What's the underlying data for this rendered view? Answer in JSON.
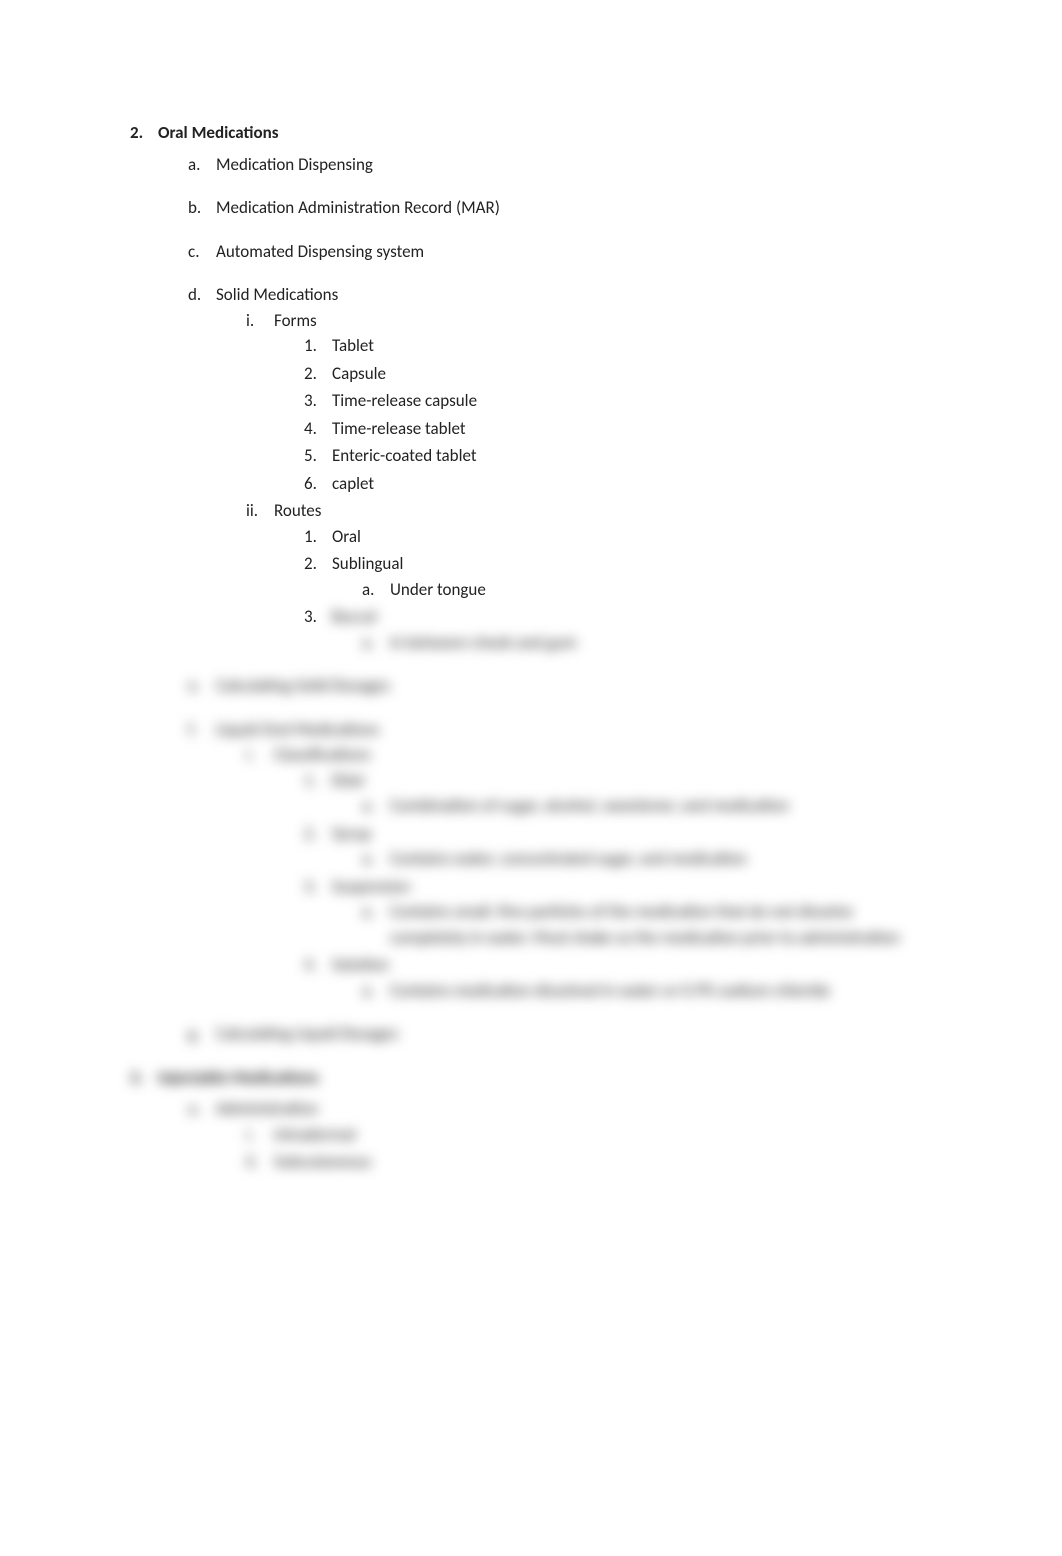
{
  "section": {
    "number": "2.",
    "title": "Oral Medications",
    "items": [
      {
        "marker": "a.",
        "text": "Medication Dispensing"
      },
      {
        "marker": "b.",
        "text": "Medication Administration Record (MAR)"
      },
      {
        "marker": "c.",
        "text": "Automated Dispensing system"
      },
      {
        "marker": "d.",
        "text": "Solid Medications",
        "sub": [
          {
            "marker": "i.",
            "text": "Forms",
            "sub": [
              {
                "marker": "1.",
                "text": "Tablet"
              },
              {
                "marker": "2.",
                "text": "Capsule"
              },
              {
                "marker": "3.",
                "text": "Time-release capsule"
              },
              {
                "marker": "4.",
                "text": "Time-release tablet"
              },
              {
                "marker": "5.",
                "text": "Enteric-coated tablet"
              },
              {
                "marker": "6.",
                "text": "caplet"
              }
            ]
          },
          {
            "marker": "ii.",
            "text": "Routes",
            "sub": [
              {
                "marker": "1.",
                "text": "Oral"
              },
              {
                "marker": "2.",
                "text": "Sublingual",
                "sub": [
                  {
                    "marker": "a.",
                    "text": "Under tongue"
                  }
                ]
              },
              {
                "marker": "3.",
                "text": "Buccal",
                "blurred": true,
                "sub": [
                  {
                    "marker": "a.",
                    "text": "In between cheek and gum",
                    "blurred": true
                  }
                ]
              }
            ]
          }
        ]
      },
      {
        "marker": "e.",
        "text": "Calculating Solid Dosages",
        "blurred": true
      },
      {
        "marker": "f.",
        "text": "Liquid Oral Medications",
        "blurred": true,
        "sub": [
          {
            "marker": "i.",
            "text": "Classifications",
            "blurred": true,
            "sub": [
              {
                "marker": "1.",
                "text": "Elixir",
                "blurred": true,
                "sub": [
                  {
                    "marker": "a.",
                    "text": "Combination of sugar, alcohol, sweetener, and medication",
                    "blurred": true
                  }
                ]
              },
              {
                "marker": "2.",
                "text": "Syrup",
                "blurred": true,
                "sub": [
                  {
                    "marker": "a.",
                    "text": "Contains water, concentrated sugar, and medication",
                    "blurred": true
                  }
                ]
              },
              {
                "marker": "3.",
                "text": "Suspension",
                "blurred": true,
                "sub": [
                  {
                    "marker": "a.",
                    "text": "Contains small, fine particles of the medication that do not dissolve completely in water. Must shake so the medication prior to administration",
                    "blurred": true
                  }
                ]
              },
              {
                "marker": "4.",
                "text": "Solution",
                "blurred": true,
                "sub": [
                  {
                    "marker": "a.",
                    "text": "Contains medication dissolved in water or 0.9% sodium chloride",
                    "blurred": true
                  }
                ]
              }
            ]
          }
        ]
      },
      {
        "marker": "g.",
        "text": "Calculating Liquid Dosages",
        "blurred": true
      }
    ]
  },
  "section3": {
    "number": "3.",
    "title": "Injectable Medications",
    "blurred": true,
    "items": [
      {
        "marker": "a.",
        "text": "Administration",
        "blurred": true,
        "sub": [
          {
            "marker": "i.",
            "text": "Intradermal",
            "blurred": true
          },
          {
            "marker": "ii.",
            "text": "Subcutaneous",
            "blurred": true
          }
        ]
      }
    ]
  }
}
